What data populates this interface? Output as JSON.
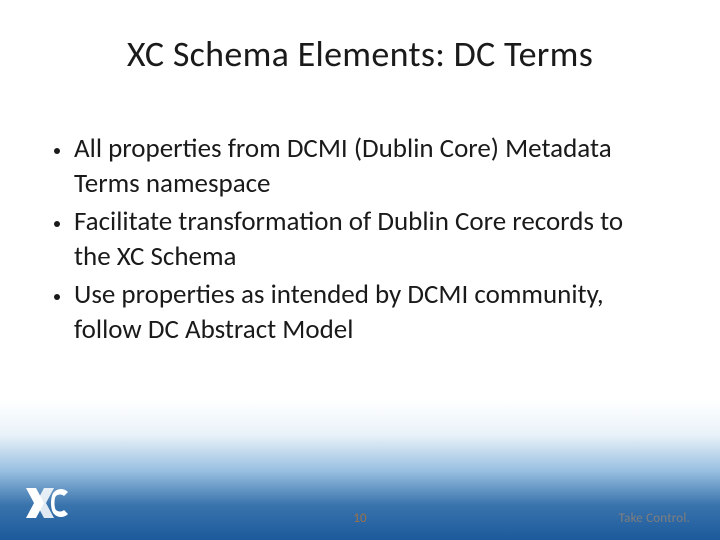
{
  "title": "XC Schema Elements:  DC Terms",
  "bullets": [
    "All properties from DCMI (Dublin Core) Metadata Terms namespace",
    "Facilitate transformation of Dublin Core records to the XC Schema",
    "Use properties as intended by DCMI community, follow DC Abstract Model"
  ],
  "page_number": "10",
  "tagline": "Take Control.",
  "logo_name": "xc-logo"
}
